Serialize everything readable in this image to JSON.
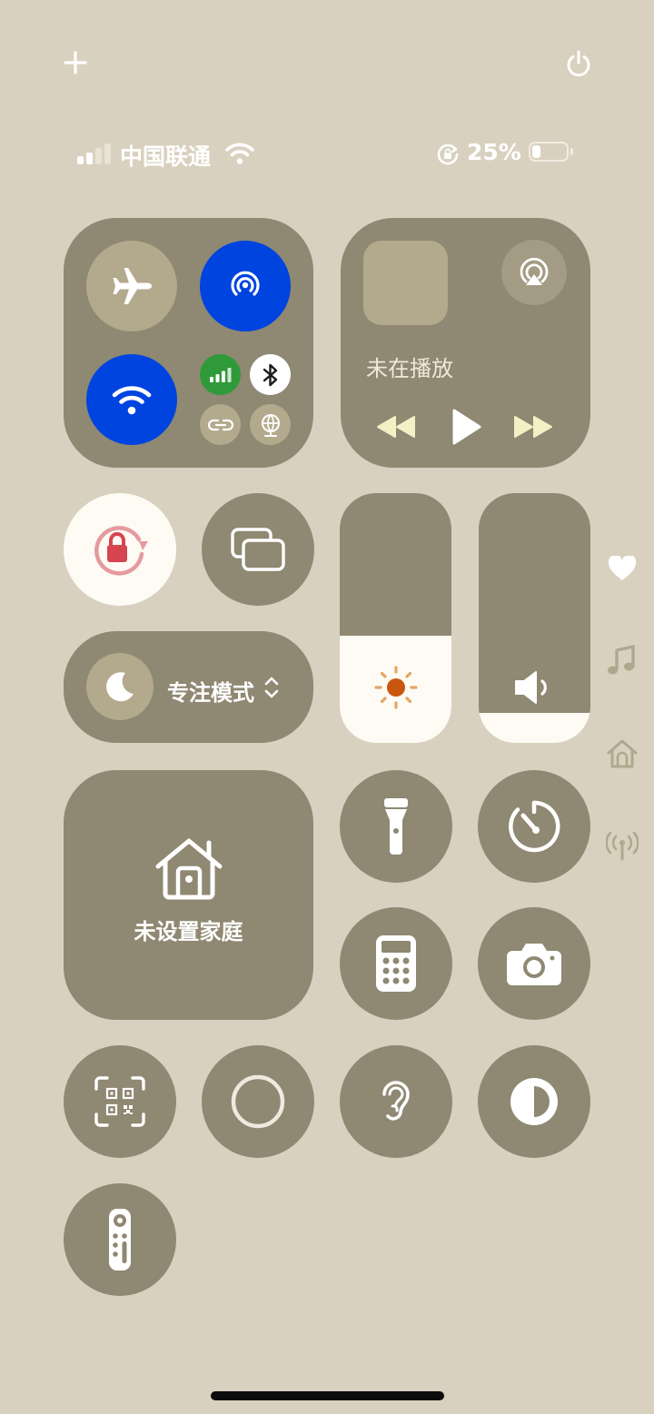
{
  "status_bar": {
    "carrier": "中国联通",
    "battery_percent_text": "25%",
    "battery_level": 0.25
  },
  "media": {
    "now_playing": "未在播放"
  },
  "focus": {
    "label": "专注模式"
  },
  "home": {
    "label": "未设置家庭"
  },
  "sliders": {
    "brightness_level": 0.43,
    "volume_level": 0.12
  },
  "colors": {
    "background": "#d9d1bf",
    "tile": "#8f8872",
    "active_blue": "#0044e0",
    "cellular_green": "#2f9a3a",
    "airplane_inactive": "#b3a98c",
    "lock_red": "#d64550",
    "sun_orange": "#c8560f"
  },
  "icons": [
    "add-icon",
    "power-icon",
    "signal-icon",
    "wifi-status-icon",
    "rotation-lock-status-icon",
    "battery-icon",
    "airplane-icon",
    "airdrop-icon",
    "wifi-icon",
    "cellular-icon",
    "bluetooth-icon",
    "hotspot-icon",
    "vpn-icon",
    "airplay-icon",
    "rewind-icon",
    "play-icon",
    "fast-forward-icon",
    "rotation-lock-icon",
    "screen-mirroring-icon",
    "moon-icon",
    "chevron-updown-icon",
    "sun-icon",
    "speaker-icon",
    "heart-icon",
    "music-note-icon",
    "home-icon",
    "antenna-icon",
    "flashlight-icon",
    "timer-icon",
    "calculator-icon",
    "camera-icon",
    "qr-code-icon",
    "circle-icon",
    "ear-icon",
    "dark-mode-icon",
    "remote-icon"
  ]
}
